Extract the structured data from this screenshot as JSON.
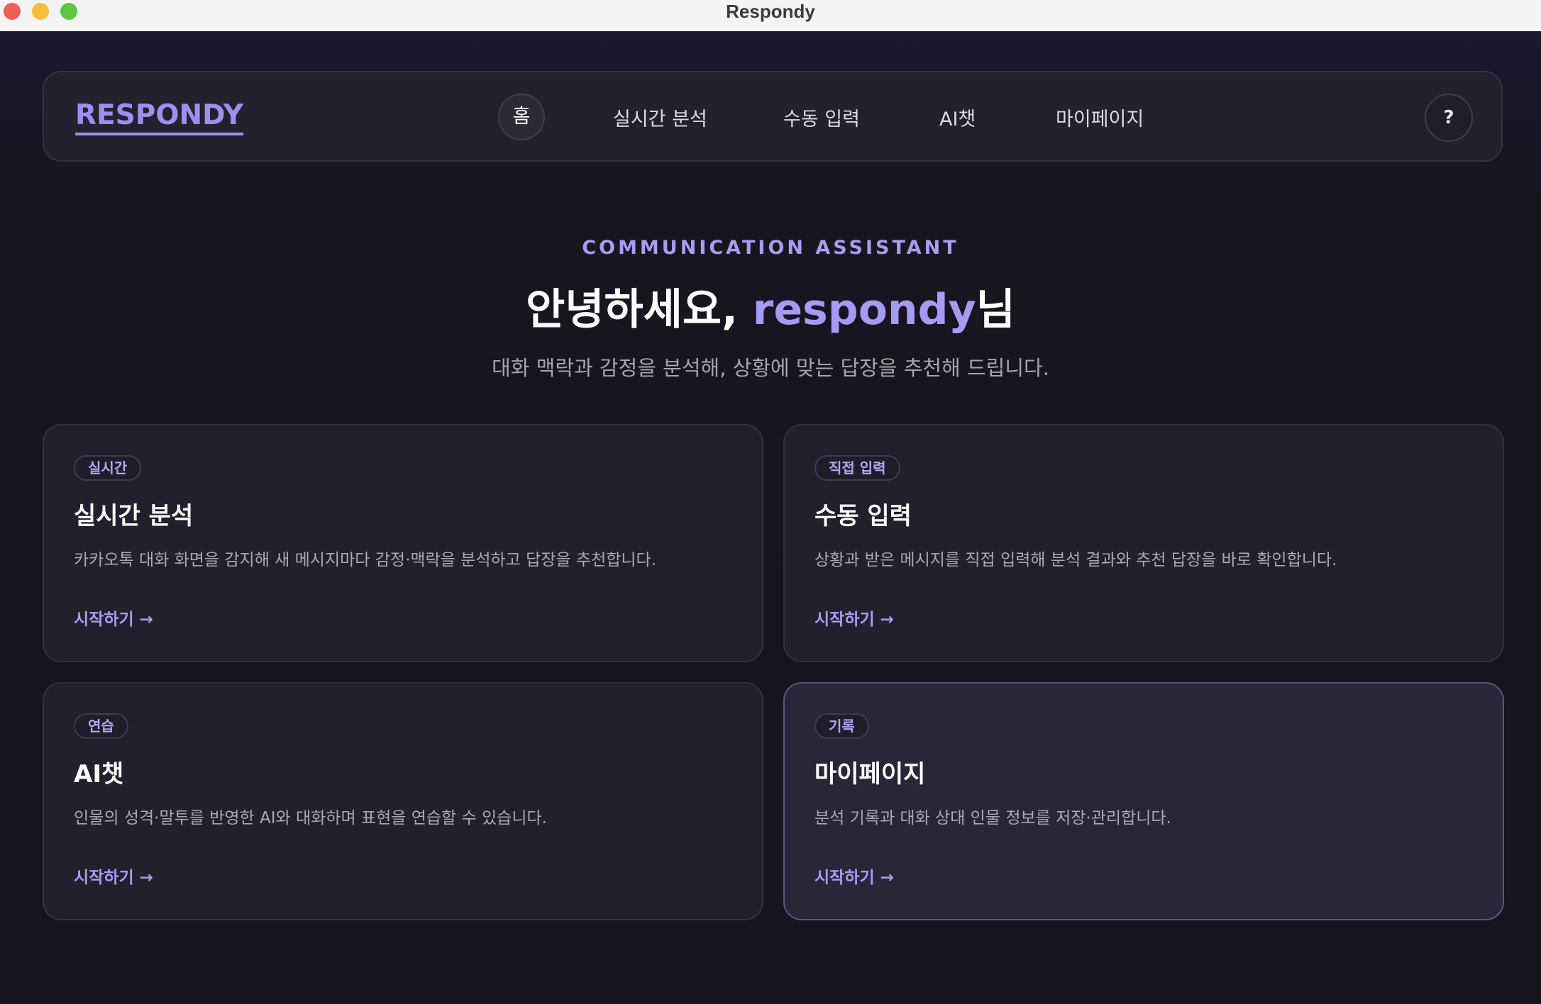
{
  "window": {
    "title": "Respondy"
  },
  "nav": {
    "logo": "RESPONDY",
    "items": [
      {
        "label": "홈"
      },
      {
        "label": "실시간 분석"
      },
      {
        "label": "수동 입력"
      },
      {
        "label": "AI챗"
      },
      {
        "label": "마이페이지"
      }
    ],
    "help": "?"
  },
  "hero": {
    "eyebrow": "COMMUNICATION ASSISTANT",
    "greeting_prefix": "안녕하세요, ",
    "username": "respondy",
    "greeting_suffix": "님",
    "subtitle": "대화 맥락과 감정을 분석해, 상황에 맞는 답장을 추천해 드립니다."
  },
  "cards": [
    {
      "badge": "실시간",
      "title": "실시간 분석",
      "description": "카카오톡 대화 화면을 감지해 새 메시지마다 감정·맥락을 분석하고 답장을 추천합니다.",
      "link": "시작하기 →"
    },
    {
      "badge": "직접 입력",
      "title": "수동 입력",
      "description": "상황과 받은 메시지를 직접 입력해 분석 결과와 추천 답장을 바로 확인합니다.",
      "link": "시작하기 →"
    },
    {
      "badge": "연습",
      "title": "AI챗",
      "description": "인물의 성격·말투를 반영한 AI와 대화하며 표현을 연습할 수 있습니다.",
      "link": "시작하기 →"
    },
    {
      "badge": "기록",
      "title": "마이페이지",
      "description": "분석 기록과 대화 상대 인물 정보를 저장·관리합니다.",
      "link": "시작하기 →"
    }
  ],
  "colors": {
    "background": "#16141f",
    "surface": "#22202d",
    "accent": "#a59af4",
    "text": "#ffffff",
    "muted": "#a6a3b2"
  }
}
